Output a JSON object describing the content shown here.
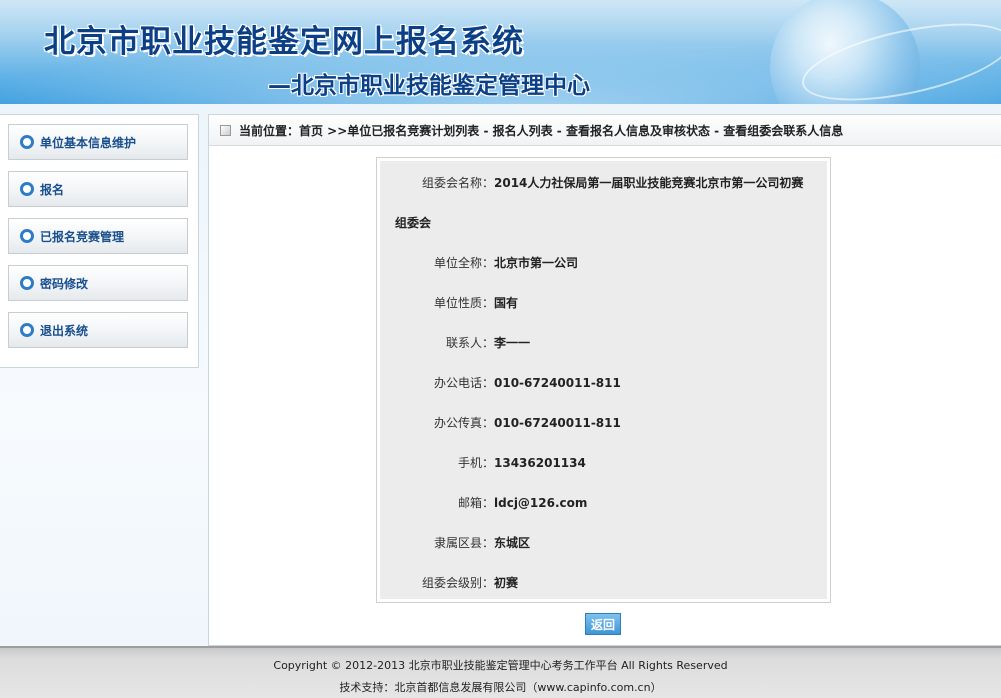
{
  "header": {
    "title": "北京市职业技能鉴定网上报名系统",
    "subtitle": "—北京市职业技能鉴定管理中心"
  },
  "sidebar": {
    "items": [
      {
        "label": "单位基本信息维护"
      },
      {
        "label": "报名"
      },
      {
        "label": "已报名竞赛管理"
      },
      {
        "label": "密码修改"
      },
      {
        "label": "退出系统"
      }
    ]
  },
  "breadcrumb": {
    "text": "当前位置：首页 >>单位已报名竞赛计划列表 - 报名人列表 - 查看报名人信息及审核状态 - 查看组委会联系人信息"
  },
  "info": {
    "committee_name_label": "组委会名称：",
    "committee_name_line1": "2014人力社保局第一届职业技能竞赛北京市第一公司初赛",
    "committee_name_line2": "组委会",
    "company_label": "单位全称：",
    "company_value": "北京市第一公司",
    "nature_label": "单位性质：",
    "nature_value": "国有",
    "contact_label": "联系人：",
    "contact_value": "李一一",
    "phone_label": "办公电话：",
    "phone_value": "010-67240011-811",
    "fax_label": "办公传真：",
    "fax_value": "010-67240011-811",
    "mobile_label": "手机：",
    "mobile_value": "13436201134",
    "email_label": "邮箱：",
    "email_value": "ldcj@126.com",
    "district_label": "隶属区县：",
    "district_value": "东城区",
    "level_label": "组委会级别：",
    "level_value": "初赛"
  },
  "actions": {
    "back_label": "返回"
  },
  "footer": {
    "copyright": "Copyright © 2012-2013 北京市职业技能鉴定管理中心考务工作平台 All Rights Reserved",
    "support": "技术支持：北京首都信息发展有限公司（www.capinfo.com.cn）"
  }
}
